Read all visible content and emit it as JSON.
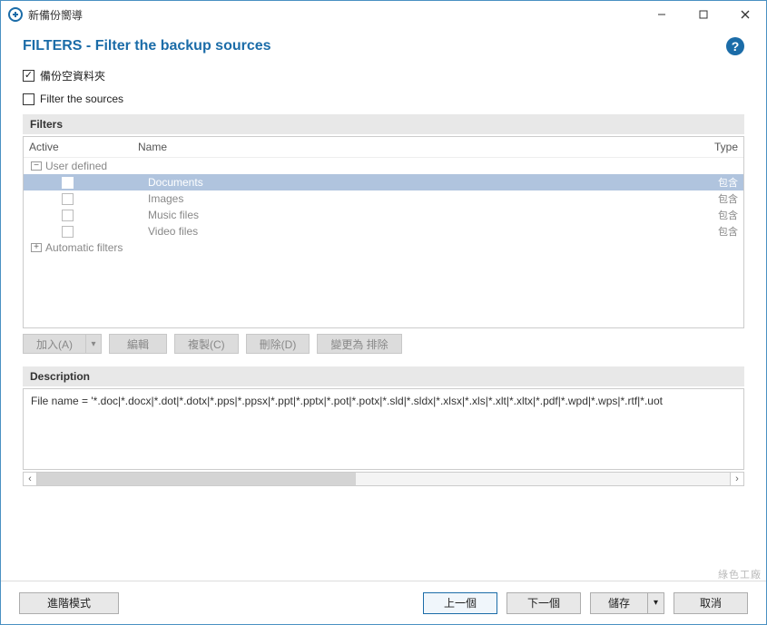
{
  "window": {
    "title": "新備份嚮導"
  },
  "header": {
    "title": "FILTERS - Filter the backup sources"
  },
  "checks": {
    "backup_empty_folders": "備份空資料夾",
    "filter_sources": "Filter the sources"
  },
  "filters": {
    "group_title": "Filters",
    "cols": {
      "active": "Active",
      "name": "Name",
      "type": "Type"
    },
    "nodes": {
      "user_defined": "User defined",
      "automatic": "Automatic filters"
    },
    "items": [
      {
        "name": "Documents",
        "type": "包含"
      },
      {
        "name": "Images",
        "type": "包含"
      },
      {
        "name": "Music files",
        "type": "包含"
      },
      {
        "name": "Video files",
        "type": "包含"
      }
    ]
  },
  "buttons": {
    "add": "加入(A)",
    "edit": "編輯",
    "copy": "複製(C)",
    "delete": "刪除(D)",
    "change_to_exclude": "變更為 排除"
  },
  "description": {
    "group_title": "Description",
    "text": "File name =  '*.doc|*.docx|*.dot|*.dotx|*.pps|*.ppsx|*.ppt|*.pptx|*.pot|*.potx|*.sld|*.sldx|*.xlsx|*.xls|*.xlt|*.xltx|*.pdf|*.wpd|*.wps|*.rtf|*.uot"
  },
  "footer": {
    "advanced": "進階模式",
    "prev": "上一個",
    "next": "下一個",
    "save": "儲存",
    "cancel": "取消"
  },
  "watermark": "綠色工廠"
}
